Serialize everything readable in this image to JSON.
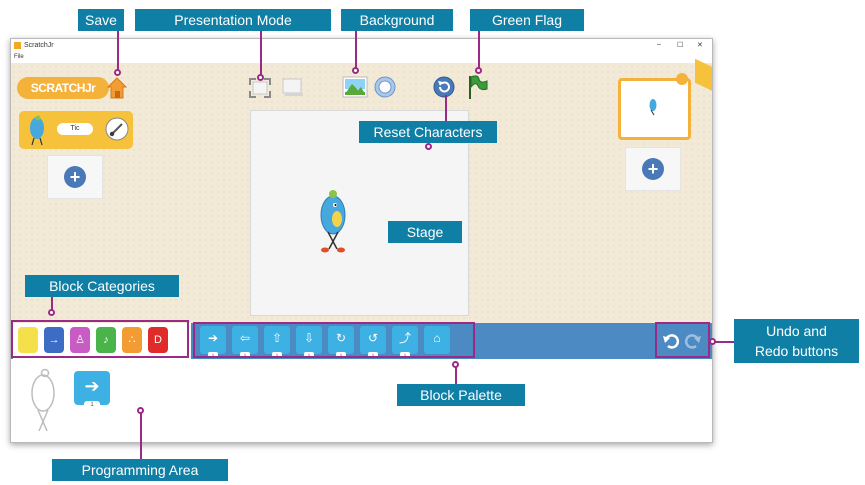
{
  "window": {
    "title": "ScratchJr",
    "menu_file": "File",
    "minimize": "–",
    "maximize": "☐",
    "close": "✕"
  },
  "app": {
    "logo_text": "SCRATCHJr",
    "sprite_name": "Tic"
  },
  "palette": {
    "block_number": "1"
  },
  "program": {
    "block_number": "1"
  },
  "callouts": {
    "save": "Save",
    "presentation_mode": "Presentation Mode",
    "background": "Background",
    "green_flag": "Green Flag",
    "reset_characters": "Reset Characters",
    "stage": "Stage",
    "block_categories": "Block Categories",
    "undo_redo_line1": "Undo and",
    "undo_redo_line2": "Redo buttons",
    "block_palette": "Block Palette",
    "programming_area": "Programming Area"
  },
  "colors": {
    "callout": "#0f7fa6",
    "leader": "#9b2a86",
    "palette_bar": "#4c8ac4",
    "block": "#3db0e4"
  },
  "icons": [
    "home-icon",
    "fullscreen-icon",
    "card-icon",
    "landscape-icon",
    "text-icon",
    "reset-icon",
    "green-flag-icon",
    "undo-icon",
    "redo-icon",
    "paintbrush-icon",
    "plus-icon"
  ]
}
